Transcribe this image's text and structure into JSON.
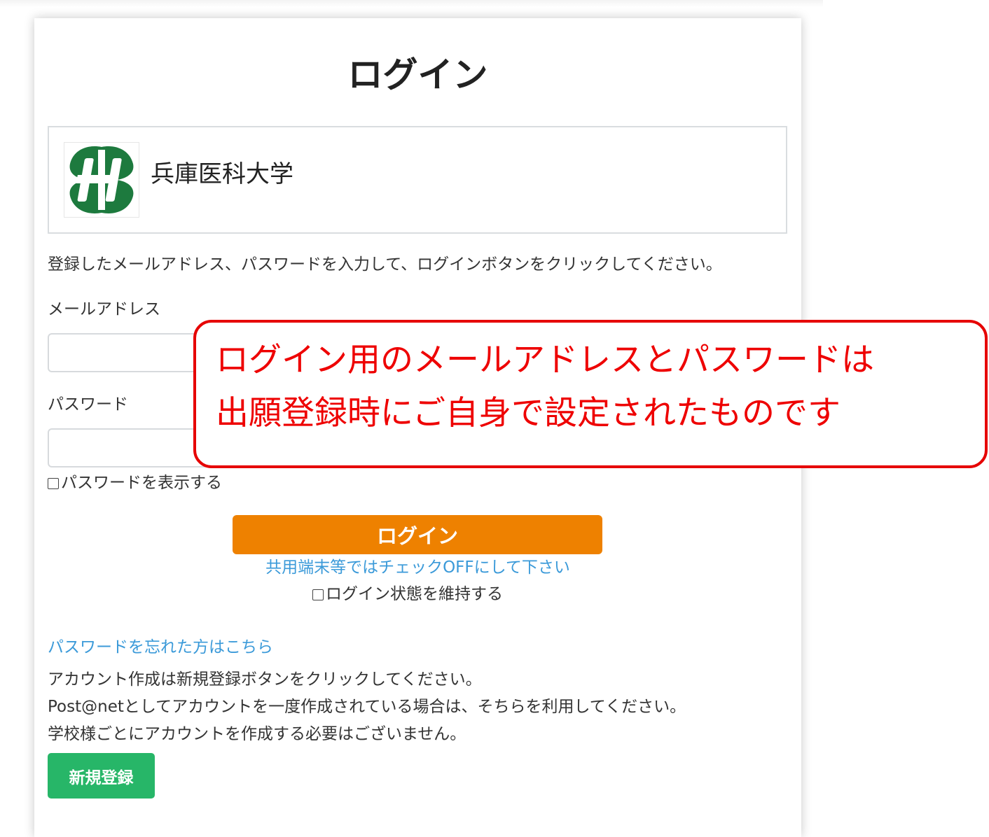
{
  "page": {
    "title": "ログイン"
  },
  "school": {
    "name": "兵庫医科大学",
    "logo_icon": "hyogo-medical-university-logo",
    "logo_color": "#1d7a3e"
  },
  "form": {
    "instruction": "登録したメールアドレス、パスワードを入力して、ログインボタンをクリックしてください。",
    "email_label": "メールアドレス",
    "email_value": "",
    "password_label": "パスワード",
    "password_value": "",
    "show_password_label": "パスワードを表示する",
    "show_password_checked": false,
    "login_button": "ログイン",
    "shared_device_hint": "共用端末等ではチェックOFFにして下さい",
    "keep_login_label": "ログイン状態を維持する",
    "keep_login_checked": false
  },
  "footer": {
    "forgot_password_link": "パスワードを忘れた方はこちら",
    "info_lines": [
      "アカウント作成は新規登録ボタンをクリックしてください。",
      "Post@netとしてアカウントを一度作成されている場合は、そちらを利用してください。",
      "学校様ごとにアカウントを作成する必要はございません。"
    ],
    "register_button": "新規登録"
  },
  "callout": {
    "lines": [
      "ログイン用のメールアドレスとパスワードは",
      "出願登録時にご自身で設定されたものです"
    ]
  },
  "colors": {
    "login_button": "#ee8100",
    "register_button": "#27b668",
    "link": "#3b9ad9",
    "callout": "#e60000"
  }
}
